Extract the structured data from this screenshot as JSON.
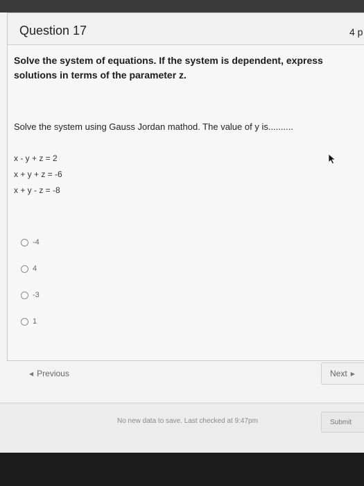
{
  "question": {
    "title": "Question 17",
    "points": "4 p",
    "instructions": "Solve the system of equations. If the system is dependent, express solutions in terms of the parameter z.",
    "prompt": "Solve the system using Gauss Jordan mathod. The value of y is..........",
    "equations": [
      "x - y + z = 2",
      "x + y + z = -6",
      "x + y - z = -8"
    ],
    "options": [
      "-4",
      "4",
      "-3",
      "1"
    ]
  },
  "nav": {
    "previous_label": "Previous",
    "next_label": "Next",
    "previous_icon": "triangle-left-icon",
    "next_icon": "triangle-right-icon"
  },
  "footer": {
    "status": "No new data to save. Last checked at 9:47pm",
    "submit_label": "Submit"
  }
}
